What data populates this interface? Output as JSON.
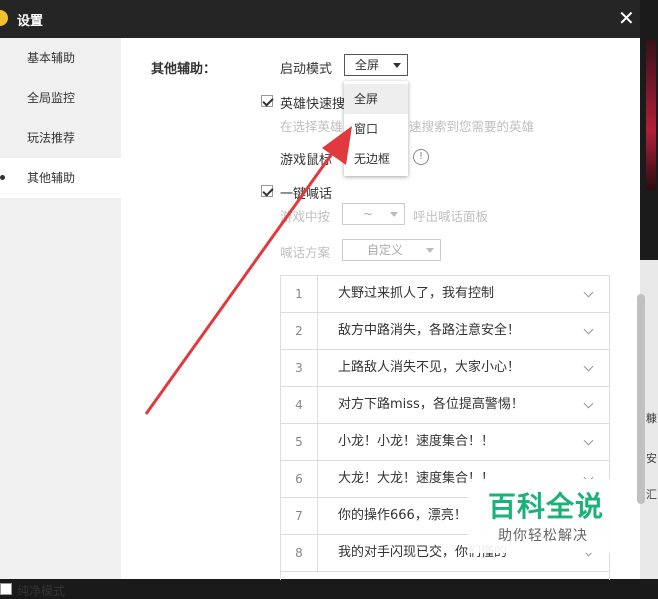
{
  "window": {
    "title": "设置"
  },
  "sidebar": {
    "items": [
      {
        "label": "基本辅助"
      },
      {
        "label": "全局监控"
      },
      {
        "label": "玩法推荐"
      },
      {
        "label": "其他辅助"
      }
    ],
    "pure_mode_label": "纯净模式",
    "pure_mode_checked": false
  },
  "main": {
    "section_label": "其他辅助：",
    "start_mode": {
      "label": "启动模式",
      "value": "全屏",
      "options": [
        "全屏",
        "窗口",
        "无边框"
      ],
      "highlighted": "全屏"
    },
    "hero_search": {
      "label": "英雄快速搜",
      "checked": true,
      "hint_left": "在选择英雄",
      "hint_right": "速搜索到您需要的英雄"
    },
    "mouse_label": "游戏鼠标",
    "info_icon": "info-icon",
    "shout": {
      "label": "一键喊话",
      "checked": true,
      "key_label": "游戏中按",
      "key_value": "~",
      "key_hint": "呼出喊话面板",
      "plan_label": "喊话方案",
      "plan_value": "自定义"
    },
    "phrases": [
      {
        "num": "1",
        "text": "大野过来抓人了，我有控制"
      },
      {
        "num": "2",
        "text": "敌方中路消失，各路注意安全！"
      },
      {
        "num": "3",
        "text": "上路敌人消失不见，大家小心！"
      },
      {
        "num": "4",
        "text": "对方下路miss，各位提高警惕！"
      },
      {
        "num": "5",
        "text": "小龙！小龙！速度集合！！"
      },
      {
        "num": "6",
        "text": "大龙！大龙！速度集合！！"
      },
      {
        "num": "7",
        "text": "你的操作666，漂亮！"
      },
      {
        "num": "8",
        "text": "我的对手闪现已交，你们懂的"
      }
    ]
  },
  "watermark": {
    "line1": "百科全说",
    "line2": "助你轻松解决"
  },
  "background_fragments": [
    "糠",
    "安",
    "汇"
  ],
  "colors": {
    "titlebar": "#252525",
    "annotation_arrow": "#e0393e",
    "watermark_green": "#19b37a"
  }
}
